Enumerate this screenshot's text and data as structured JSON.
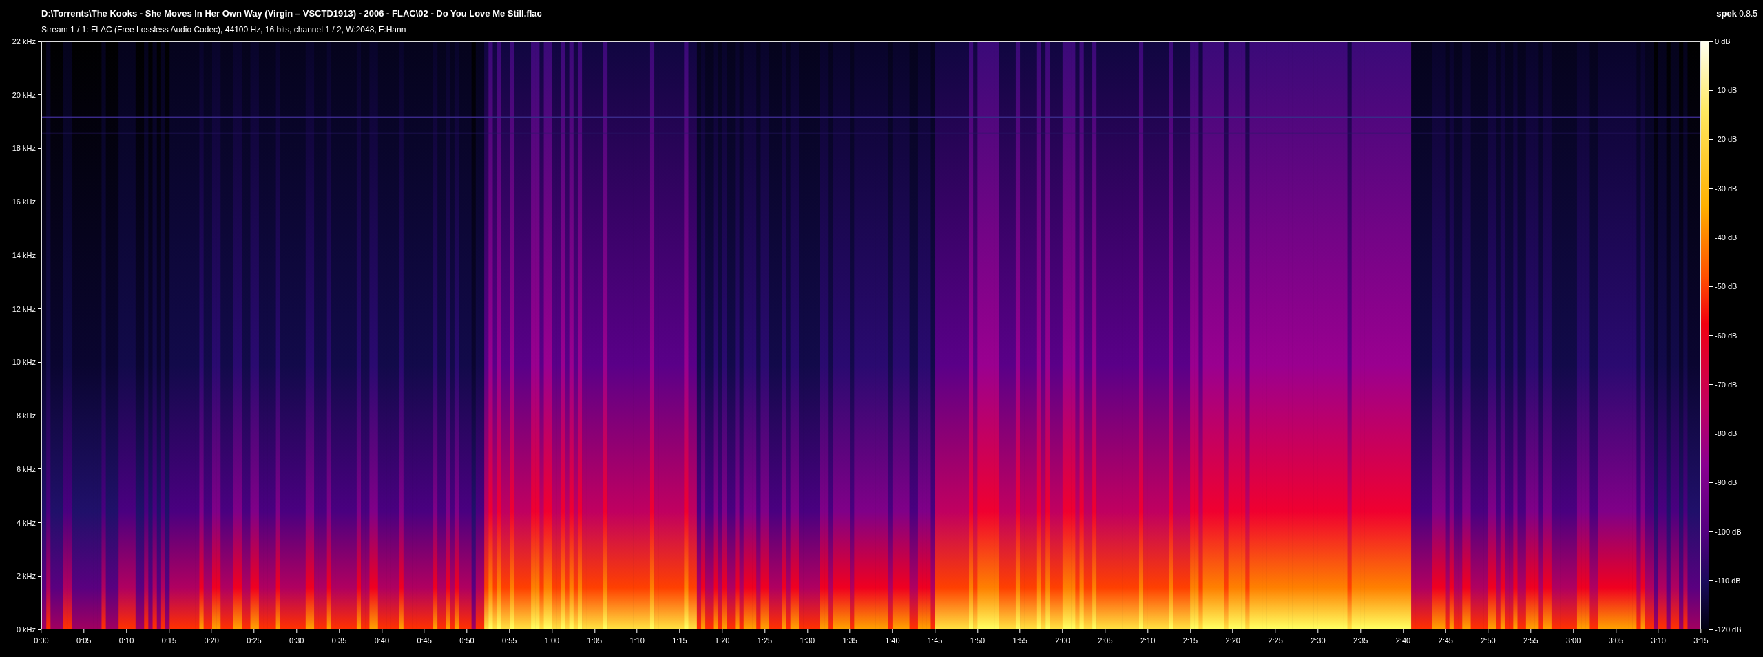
{
  "header": {
    "title": "D:\\Torrents\\The Kooks - She Moves In Her Own Way (Virgin – VSCTD1913) - 2006 - FLAC\\02 - Do You Love Me Still.flac",
    "stream_info": "Stream 1 / 1: FLAC (Free Lossless Audio Codec), 44100 Hz, 16 bits, channel 1 / 2, W:2048, F:Hann"
  },
  "logo": {
    "name": "spek",
    "version": "0.8.5"
  },
  "frequency_axis": {
    "ticks": [
      "22 kHz",
      "20 kHz",
      "18 kHz",
      "16 kHz",
      "14 kHz",
      "12 kHz",
      "10 kHz",
      "8 kHz",
      "6 kHz",
      "4 kHz",
      "2 kHz",
      "0 kHz"
    ]
  },
  "time_axis": {
    "ticks": [
      "0:00",
      "0:05",
      "0:10",
      "0:15",
      "0:20",
      "0:25",
      "0:30",
      "0:35",
      "0:40",
      "0:45",
      "0:50",
      "0:55",
      "1:00",
      "1:05",
      "1:10",
      "1:15",
      "1:20",
      "1:25",
      "1:30",
      "1:35",
      "1:40",
      "1:45",
      "1:50",
      "1:55",
      "2:00",
      "2:05",
      "2:10",
      "2:15",
      "2:20",
      "2:25",
      "2:30",
      "2:35",
      "2:40",
      "2:45",
      "2:50",
      "2:55",
      "3:00",
      "3:05",
      "3:10",
      "3:15"
    ]
  },
  "db_scale": {
    "ticks": [
      "0 dB",
      "-10 dB",
      "-20 dB",
      "-30 dB",
      "-40 dB",
      "-50 dB",
      "-60 dB",
      "-70 dB",
      "-80 dB",
      "-90 dB",
      "-100 dB",
      "-110 dB",
      "-120 dB"
    ]
  }
}
